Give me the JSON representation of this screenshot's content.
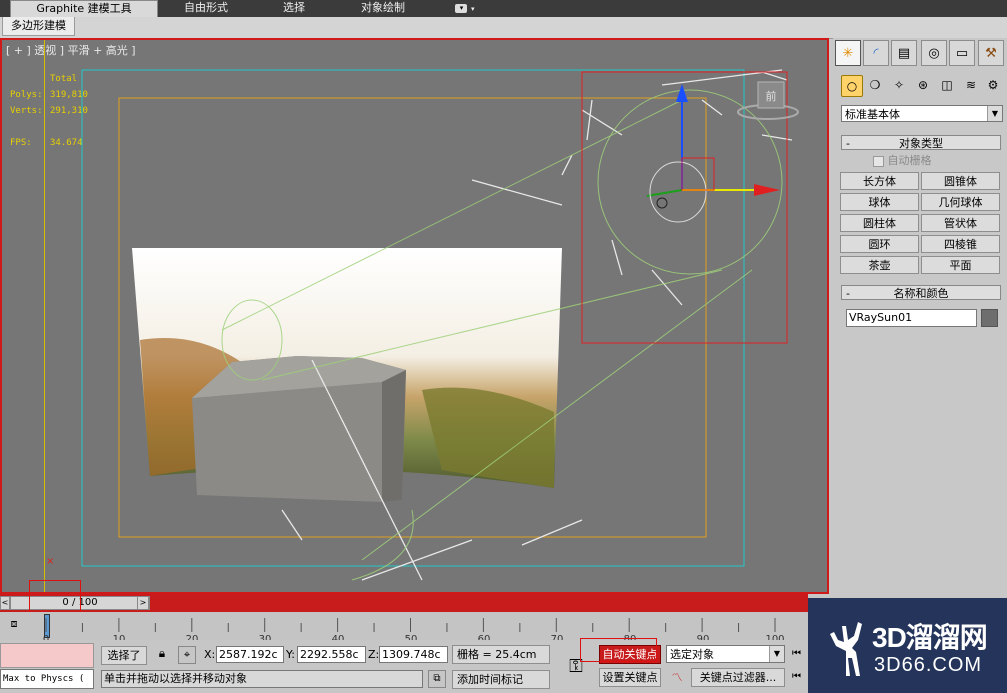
{
  "ribbon": {
    "tabs": [
      "Graphite 建模工具",
      "自由形式",
      "选择",
      "对象绘制"
    ],
    "extra": "▾"
  },
  "subtabs": [
    "多边形建模"
  ],
  "viewport": {
    "label": "[ + ] 透视 ] 平滑 + 高光 ]",
    "stats": {
      "total_label": "Total",
      "polys_label": "Polys:",
      "polys_value": "319,810",
      "verts_label": "Verts:",
      "verts_value": "291,310",
      "fps_label": "FPS:",
      "fps_value": "34.674"
    },
    "viewcube_label": "前"
  },
  "command_panel": {
    "tab_icons": [
      "create-icon",
      "modify-icon",
      "hierarchy-icon",
      "motion-icon",
      "display-icon",
      "utilities-icon"
    ],
    "category_icons": [
      "geometry-icon",
      "shapes-icon",
      "lights-icon",
      "cameras-icon",
      "helpers-icon",
      "spacewarps-icon",
      "systems-icon"
    ],
    "category_dropdown": "标准基本体",
    "object_type_title": "对象类型",
    "autogrid_label": "自动栅格",
    "buttons": [
      "长方体",
      "圆锥体",
      "球体",
      "几何球体",
      "圆柱体",
      "管状体",
      "圆环",
      "四棱锥",
      "茶壶",
      "平面"
    ],
    "name_color_title": "名称和颜色",
    "object_name": "VRaySun01",
    "object_color": "#6e6e6e"
  },
  "timeline": {
    "slider_label": "0 / 100",
    "ticks": [
      "0",
      "10",
      "20",
      "30",
      "40",
      "50",
      "60",
      "70",
      "80",
      "90",
      "100"
    ]
  },
  "status": {
    "maxscript": "Max to Physcs (",
    "selection": "选择了",
    "x_label": "X:",
    "x_value": "2587.192c",
    "y_label": "Y:",
    "y_value": "2292.558c",
    "z_label": "Z:",
    "z_value": "1309.748c",
    "grid": "栅格 = 25.4cm",
    "prompt": "单击并拖动以选择并移动对象",
    "add_time_tag": "添加时间标记",
    "auto_key": "自动关键点",
    "set_key": "设置关键点",
    "selected_dropdown": "选定对象",
    "key_filters": "关键点过滤器..."
  },
  "logo": {
    "brand": "3D溜溜网",
    "url": "3D66.COM"
  },
  "colors": {
    "accent_red": "#c81c1c",
    "auto_key_red": "#c81c1c",
    "stat_yellow": "#e8d000",
    "viewport_gray": "#767676"
  }
}
